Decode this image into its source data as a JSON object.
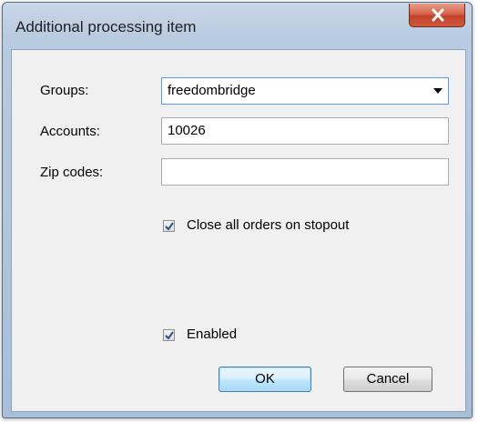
{
  "window": {
    "title": "Additional processing item",
    "close_icon": "close-x-icon"
  },
  "form": {
    "groups": {
      "label": "Groups:",
      "value": "freedombridge",
      "dropdown_icon": "chevron-down-icon"
    },
    "accounts": {
      "label": "Accounts:",
      "value": "10026"
    },
    "zip_codes": {
      "label": "Zip codes:",
      "value": ""
    },
    "close_orders_checkbox": {
      "label": "Close all orders on stopout",
      "checked": true
    },
    "enabled_checkbox": {
      "label": "Enabled",
      "checked": true
    }
  },
  "buttons": {
    "ok": "OK",
    "cancel": "Cancel"
  },
  "colors": {
    "title_bar": "#b9cbe0",
    "close_button": "#c2412a",
    "client_area": "#f0f0f0",
    "focus_border": "#569de5"
  }
}
